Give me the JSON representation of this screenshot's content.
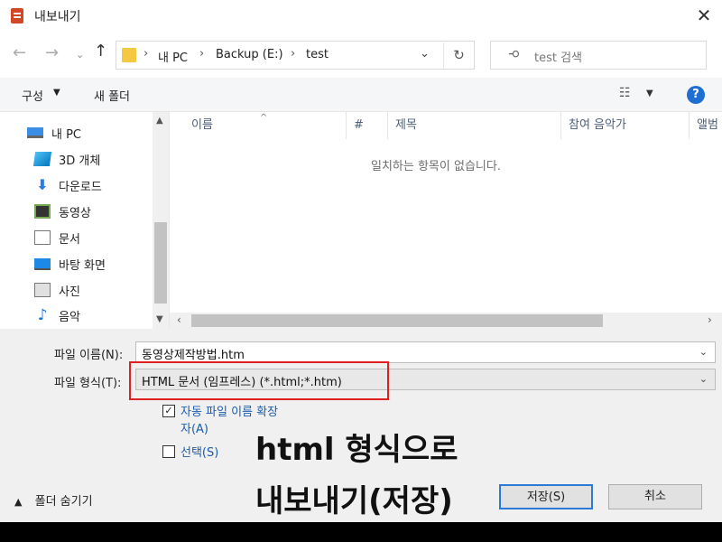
{
  "window": {
    "title": "내보내기",
    "close_glyph": "✕"
  },
  "nav": {
    "back_glyph": "←",
    "forward_glyph": "→",
    "recent_glyph": "⌄",
    "up_glyph": "↑",
    "breadcrumbs": [
      "내 PC",
      "Backup (E:)",
      "test"
    ],
    "crumb_sep": "›",
    "refresh_glyph": "↻",
    "dropdown_glyph": "⌄",
    "search_placeholder": "test 검색"
  },
  "toolbar": {
    "organize_label": "구성",
    "new_folder_label": "새 폴더",
    "help_glyph": "?"
  },
  "nav_pane": {
    "items": [
      {
        "label": "내 PC",
        "icon": "computer-icon"
      },
      {
        "label": "3D 개체",
        "icon": "cube-icon"
      },
      {
        "label": "다운로드",
        "icon": "download-icon"
      },
      {
        "label": "동영상",
        "icon": "video-icon"
      },
      {
        "label": "문서",
        "icon": "document-icon"
      },
      {
        "label": "바탕 화면",
        "icon": "desktop-icon"
      },
      {
        "label": "사진",
        "icon": "picture-icon"
      },
      {
        "label": "음악",
        "icon": "music-icon"
      }
    ]
  },
  "file_list": {
    "columns": [
      "이름",
      "#",
      "제목",
      "참여 음악가",
      "앨범"
    ],
    "empty_message": "일치하는 항목이 없습니다."
  },
  "form": {
    "filename_label": "파일 이름(N):",
    "filename_value": "동영상제작방법.htm",
    "filetype_label": "파일 형식(T):",
    "filetype_value": "HTML 문서 (임프레스) (*.html;*.htm)",
    "auto_ext_label_line1": "자동 파일 이름 확장",
    "auto_ext_label_line2": "자(A)",
    "auto_ext_checked": true,
    "select_label": "선택(S)",
    "select_checked": false
  },
  "overlay": {
    "line1": "html 형식으로",
    "line2": "내보내기(저장)"
  },
  "footer": {
    "hide_folders_label": "폴더 숨기기",
    "save_label": "저장(S)",
    "cancel_label": "취소"
  },
  "colors": {
    "accent": "#2b79d9",
    "highlight_box": "#e02020",
    "help": "#1f6fd1"
  }
}
